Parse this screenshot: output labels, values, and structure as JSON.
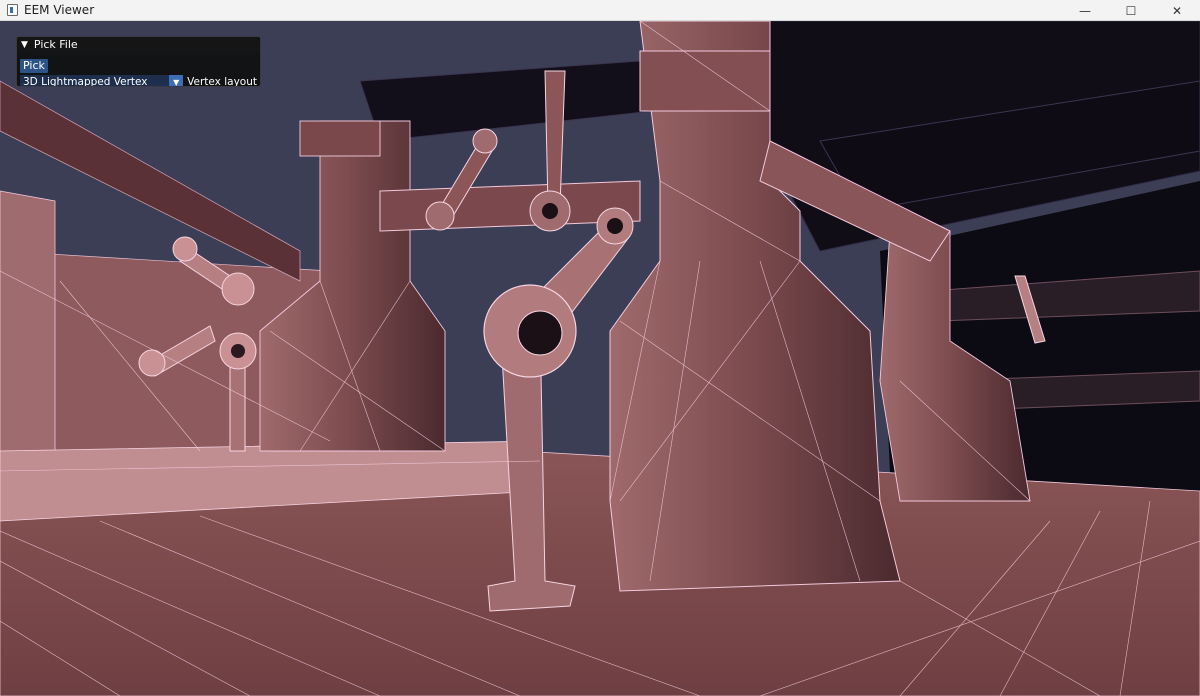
{
  "window": {
    "title": "EEM Viewer",
    "minimize": "—",
    "maximize": "☐",
    "close": "✕"
  },
  "panel": {
    "title": "Pick File",
    "pick_label": "Pick",
    "vertex_layout_value": "3D Lightmapped Vertex",
    "vertex_layout_label": "Vertex layout"
  },
  "colors": {
    "sky": "#3d3f56",
    "mesh": "#8c5a5c",
    "wire": "#f2c9dc"
  }
}
